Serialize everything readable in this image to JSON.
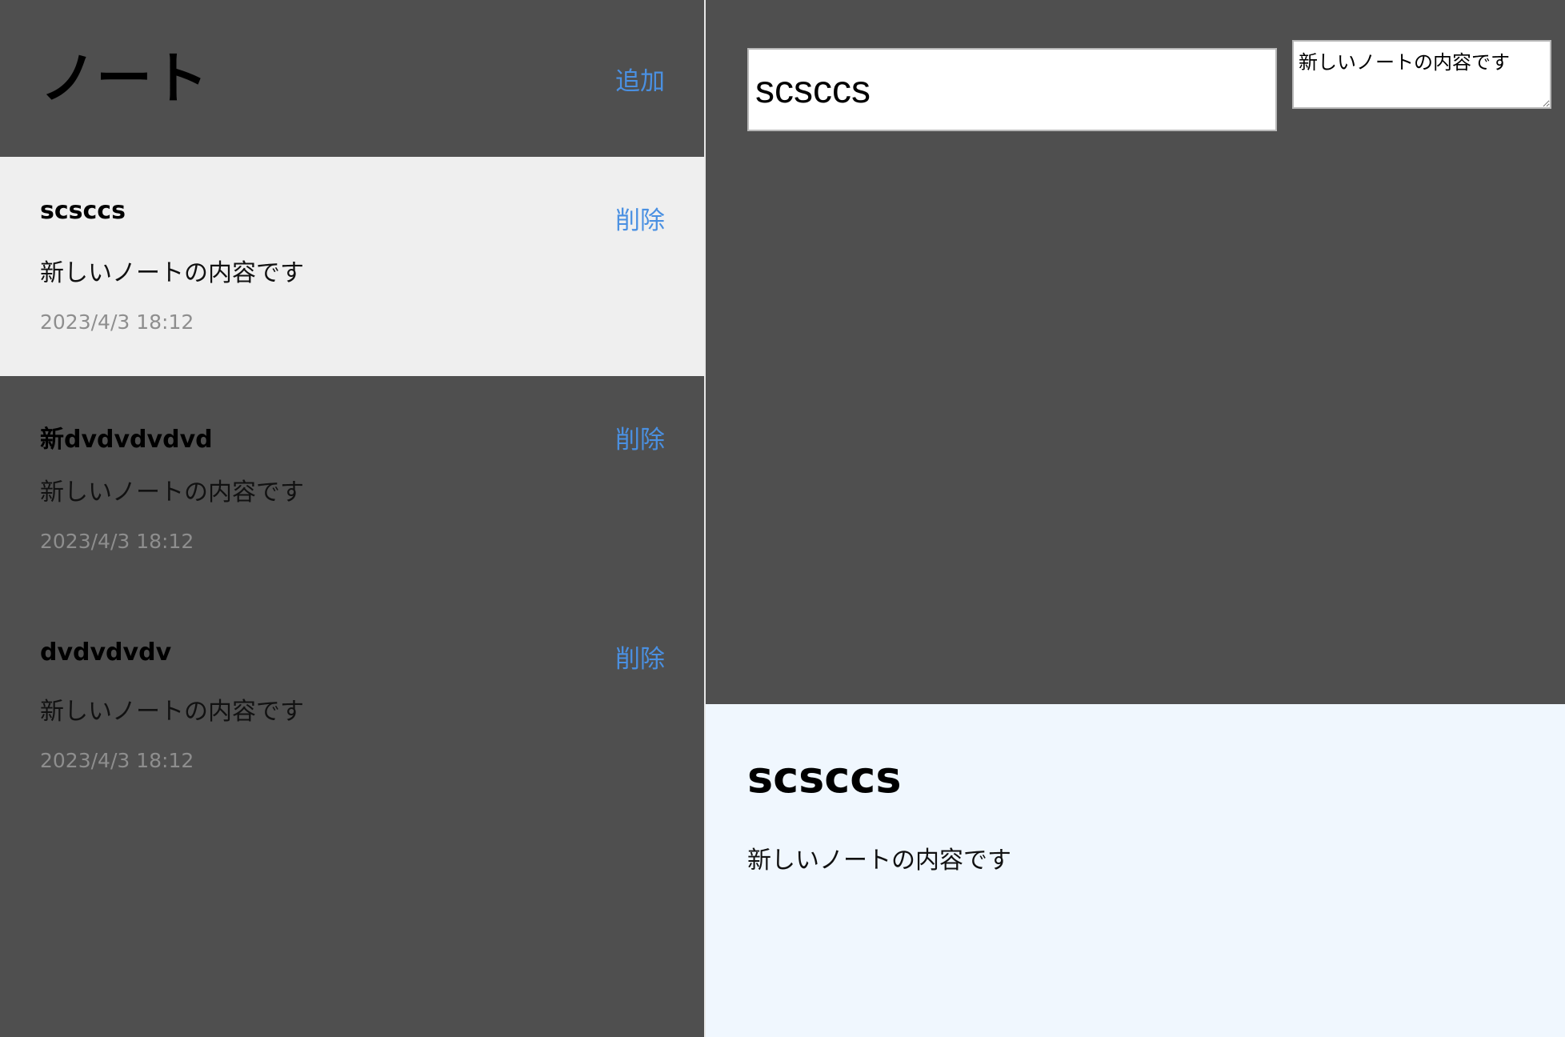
{
  "sidebar": {
    "title": "ノート",
    "add_label": "追加",
    "notes": [
      {
        "title": "scsccs",
        "body": "新しいノートの内容です",
        "date": "2023/4/3 18:12",
        "delete_label": "削除",
        "active": true
      },
      {
        "title": "新dvdvdvdvd",
        "body": "新しいノートの内容です",
        "date": "2023/4/3 18:12",
        "delete_label": "削除",
        "active": false
      },
      {
        "title": "dvdvdvdv",
        "body": "新しいノートの内容です",
        "date": "2023/4/3 18:12",
        "delete_label": "削除",
        "active": false
      }
    ]
  },
  "editor": {
    "title_value": "scsccs",
    "body_value": "新しいノートの内容です"
  },
  "preview": {
    "title": "scsccs",
    "body": "新しいノートの内容です"
  },
  "colors": {
    "background": "#4f4f4f",
    "active_item": "#efefef",
    "accent": "#4a90e2",
    "preview_bg": "#f0f7fe",
    "date_text": "#8e8e8e"
  }
}
